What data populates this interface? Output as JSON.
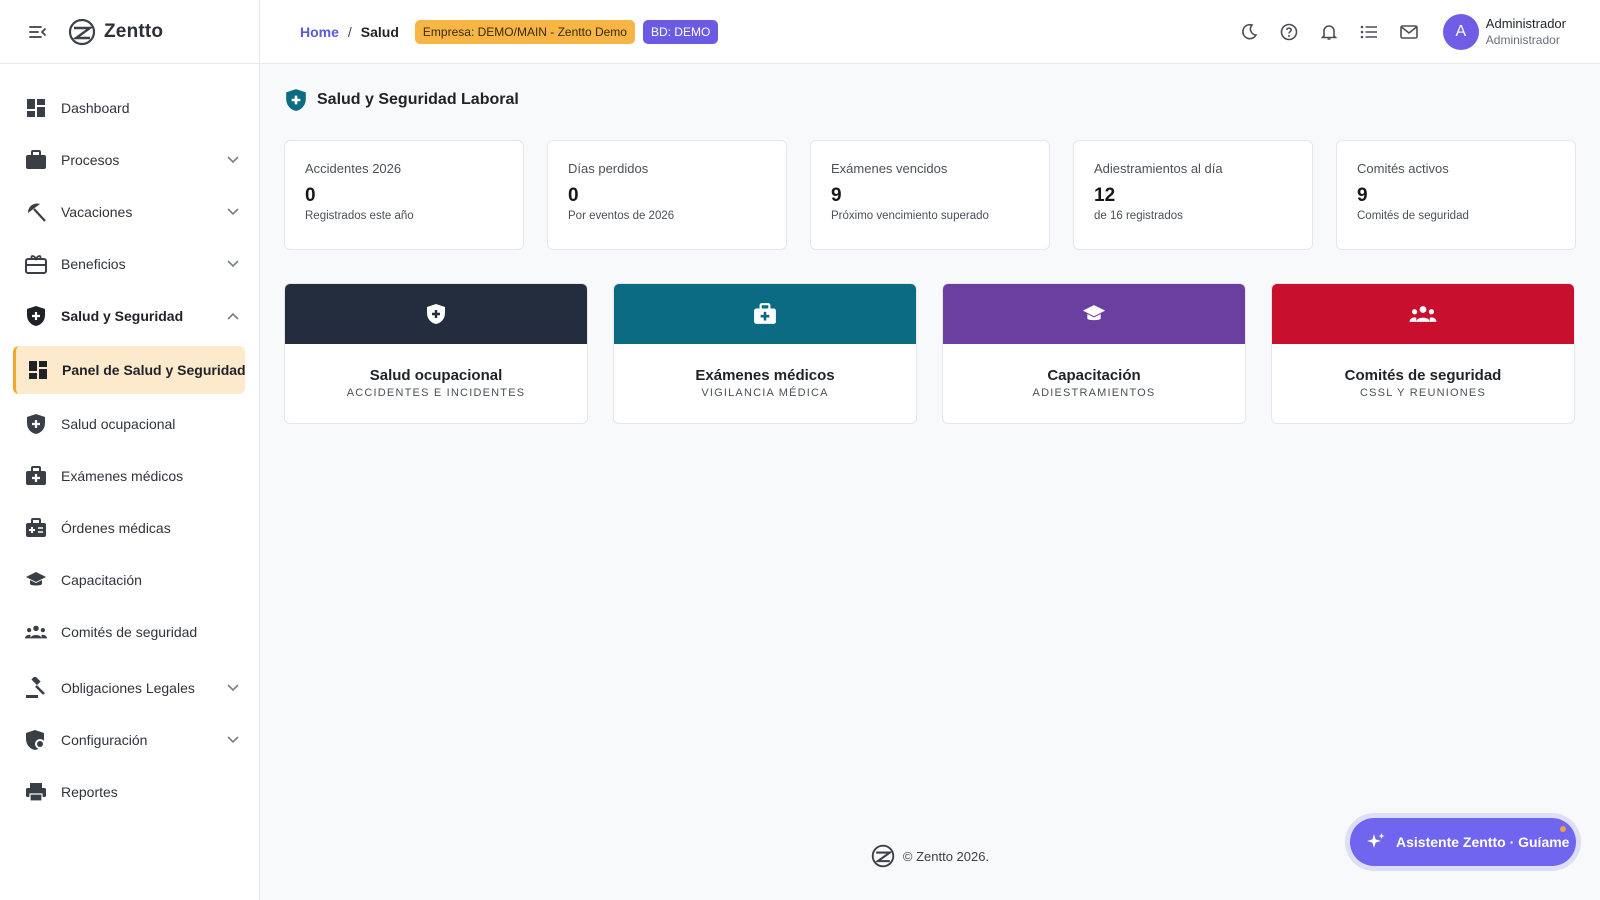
{
  "brand": {
    "name": "Zentto"
  },
  "sidebar": {
    "items": [
      {
        "label": "Dashboard"
      },
      {
        "label": "Procesos"
      },
      {
        "label": "Vacaciones"
      },
      {
        "label": "Beneficios"
      },
      {
        "label": "Salud y Seguridad"
      },
      {
        "label": "Panel de Salud y Seguridad"
      },
      {
        "label": "Salud ocupacional"
      },
      {
        "label": "Exámenes médicos"
      },
      {
        "label": "Órdenes médicas"
      },
      {
        "label": "Capacitación"
      },
      {
        "label": "Comités de seguridad"
      },
      {
        "label": "Obligaciones Legales"
      },
      {
        "label": "Configuración"
      },
      {
        "label": "Reportes"
      }
    ]
  },
  "topbar": {
    "breadcrumb_home": "Home",
    "breadcrumb_sep": "/",
    "breadcrumb_current": "Salud",
    "badge_empresa": "Empresa: DEMO/MAIN - Zentto Demo",
    "badge_bd": "BD: DEMO",
    "user_initial": "A",
    "user_name": "Administrador",
    "user_role": "Administrador"
  },
  "page": {
    "title": "Salud y Seguridad Laboral"
  },
  "stats": [
    {
      "label": "Accidentes 2026",
      "value": "0",
      "sub": "Registrados este año"
    },
    {
      "label": "Días perdidos",
      "value": "0",
      "sub": "Por eventos de 2026"
    },
    {
      "label": "Exámenes vencidos",
      "value": "9",
      "sub": "Próximo vencimiento superado"
    },
    {
      "label": "Adiestramientos al día",
      "value": "12",
      "sub": "de 16 registrados"
    },
    {
      "label": "Comités activos",
      "value": "9",
      "sub": "Comités de seguridad"
    }
  ],
  "modules": [
    {
      "title": "Salud ocupacional",
      "sub": "ACCIDENTES E INCIDENTES",
      "color": "#232d3d",
      "icon": "shield-plus-icon"
    },
    {
      "title": "Exámenes médicos",
      "sub": "VIGILANCIA MÉDICA",
      "color": "#0a6b82",
      "icon": "medical-kit-icon"
    },
    {
      "title": "Capacitación",
      "sub": "ADIESTRAMIENTOS",
      "color": "#6b3fa0",
      "icon": "graduation-cap-icon"
    },
    {
      "title": "Comités de seguridad",
      "sub": "CSSL Y REUNIONES",
      "color": "#c8102e",
      "icon": "group-icon"
    }
  ],
  "footer": {
    "text": "© Zentto 2026."
  },
  "assistant": {
    "label": "Asistente Zentto · Guíame"
  },
  "colors": {
    "accent": "#6a5be2",
    "active_bg": "#fde9cc",
    "active_border": "#f4a62a",
    "page_icon": "#0a6b82"
  }
}
